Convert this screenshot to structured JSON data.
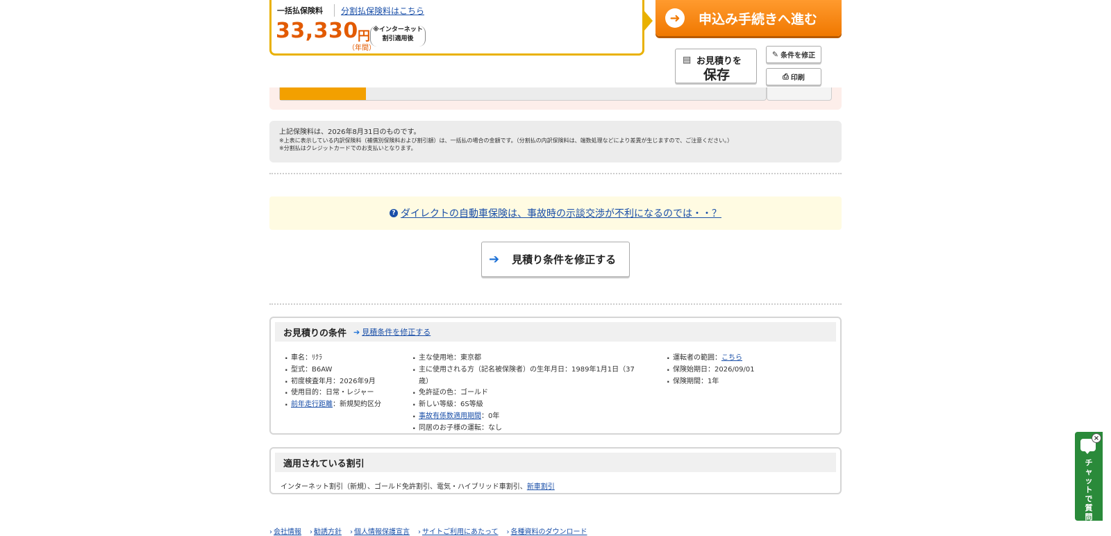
{
  "premium": {
    "label": "一括払保険料",
    "installment_link": "分割払保険料はこちら",
    "amount": "33,330",
    "yen": "円",
    "annual": "（年間）",
    "note_line1": "※インターネット",
    "note_line2": "割引適用後"
  },
  "actions": {
    "apply_label": "申込み手続きへ進む",
    "save_line1": "お見積りを",
    "save_line2": "保存",
    "modify_small_label": "条件を修正",
    "print_label": "印刷"
  },
  "notice": {
    "line1": "上記保険料は、2026年8月31日のものです。",
    "line2": "※上表に表示している内訳保険料（補償別保険料および割引額）は、一括払の場合の金額です。（分割払の内訳保険料は、端数処理などにより差異が生じますので、ご注意ください。）",
    "line3": "※分割払はクレジットカードでのお支払いとなります。"
  },
  "faq": {
    "link": "ダイレクトの自動車保険は、事故時の示談交渉が不利になるのでは・・？"
  },
  "modify_button": "見積り条件を修正する",
  "conditions": {
    "title": "お見積りの条件",
    "edit_link": "見積条件を修正する",
    "col1": {
      "car_name": "車名：ﾘｸﾗ",
      "model": "型式：B6AW",
      "first_reg": "初度検査年月：2026年9月",
      "purpose": "使用目的：日常・レジャー",
      "mileage_link": "前年走行距離",
      "mileage_value": "：新規契約区分"
    },
    "col2": {
      "location": "主な使用地：東京都",
      "birth_line1": "主に使用される方（記名被保険者）の生年月日：1989年1月1日（37",
      "birth_line2": "歳）",
      "license": "免許証の色：ゴールド",
      "grade": "新しい等級：6S等級",
      "accident_link": "事故有係数適用期間",
      "accident_value": "：0年",
      "children": "同居のお子様の運転：なし"
    },
    "col3": {
      "driver_range_label": "運転者の範囲：",
      "driver_range_link": "こちら",
      "start_date": "保険始期日：2026/09/01",
      "period": "保険期間：1年"
    }
  },
  "discounts": {
    "title": "適用されている割引",
    "text": "インターネット割引（新規）、ゴールド免許割引、電気・ハイブリッド車割引、",
    "link": "新車割引"
  },
  "footer": {
    "items": [
      "会社情報",
      "勧誘方針",
      "個人情報保護宣言",
      "サイトご利用にあたって",
      "各種資料のダウンロード"
    ]
  },
  "chat": {
    "label": "チャットで質問",
    "close": "×"
  },
  "colors": {
    "accent_orange": "#f07800",
    "premium_border": "#e9b100",
    "link_blue": "#1a4fa8",
    "chat_green": "#2a8a3a"
  }
}
